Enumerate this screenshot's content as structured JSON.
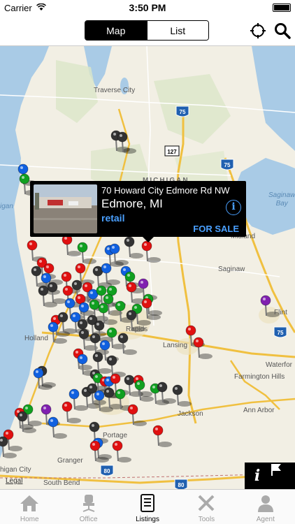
{
  "status_bar": {
    "carrier": "Carrier",
    "time": "3:50 PM"
  },
  "header": {
    "segments": [
      {
        "label": "Map",
        "selected": true
      },
      {
        "label": "List",
        "selected": false
      }
    ],
    "icons": [
      "locate-icon",
      "search-icon"
    ]
  },
  "map": {
    "labels": {
      "traverse_city": "Traverse City",
      "michigan": "MICHIGAN",
      "saginaw_bay": "Saginaw\nBay",
      "midland": "Midland",
      "saginaw": "Saginaw",
      "flint": "Flint",
      "holland": "Holland",
      "rapids": "Rapids",
      "lansing": "Lansing",
      "waterford": "Waterfor",
      "farmington_hills": "Farmington Hills",
      "ann_arbor": "Ann Arbor",
      "jackson": "Jackson",
      "portage": "Portage",
      "granger": "Granger",
      "south_bend": "South Bend",
      "michigan_city": "higan City",
      "lake_michigan": "igan",
      "i75_a": "75",
      "i75_b": "75",
      "i75_c": "75",
      "us127": "127",
      "i80": "80",
      "i80b": "80"
    },
    "legal": "Legal",
    "pin_colors": {
      "red": "#e01010",
      "green": "#10a020",
      "blue": "#1060e0",
      "gray": "#333333",
      "purple": "#8020b0"
    }
  },
  "callout": {
    "address": "70 Howard City Edmore Rd NW",
    "city": "Edmore, MI",
    "type": "retail",
    "status": "FOR SALE",
    "info_glyph": "i"
  },
  "map_buttons": {
    "info_glyph": "i",
    "flag_icon": "flag-icon"
  },
  "tabs": [
    {
      "label": "Home",
      "icon": "home-icon",
      "active": false
    },
    {
      "label": "Office",
      "icon": "office-chair-icon",
      "active": false
    },
    {
      "label": "Listings",
      "icon": "listings-icon",
      "active": true
    },
    {
      "label": "Tools",
      "icon": "tools-icon",
      "active": false
    },
    {
      "label": "Agent",
      "icon": "agent-icon",
      "active": false
    }
  ]
}
